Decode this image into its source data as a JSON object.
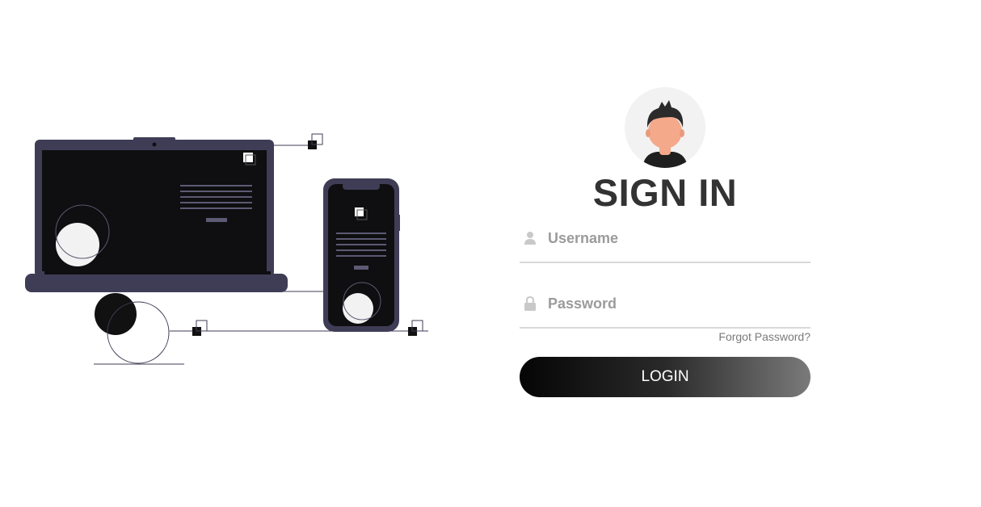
{
  "login": {
    "title": "SIGN IN",
    "username_placeholder": "Username",
    "password_placeholder": "Password",
    "forgot_password": "Forgot Password?",
    "login_button": "LOGIN"
  },
  "colors": {
    "device_frame": "#3f3d56",
    "screen": "#0f0e10",
    "title": "#333333",
    "button_gradient_start": "#050505",
    "button_gradient_end": "#7a7a7a"
  },
  "icons": {
    "username": "user-icon",
    "password": "lock-icon"
  }
}
